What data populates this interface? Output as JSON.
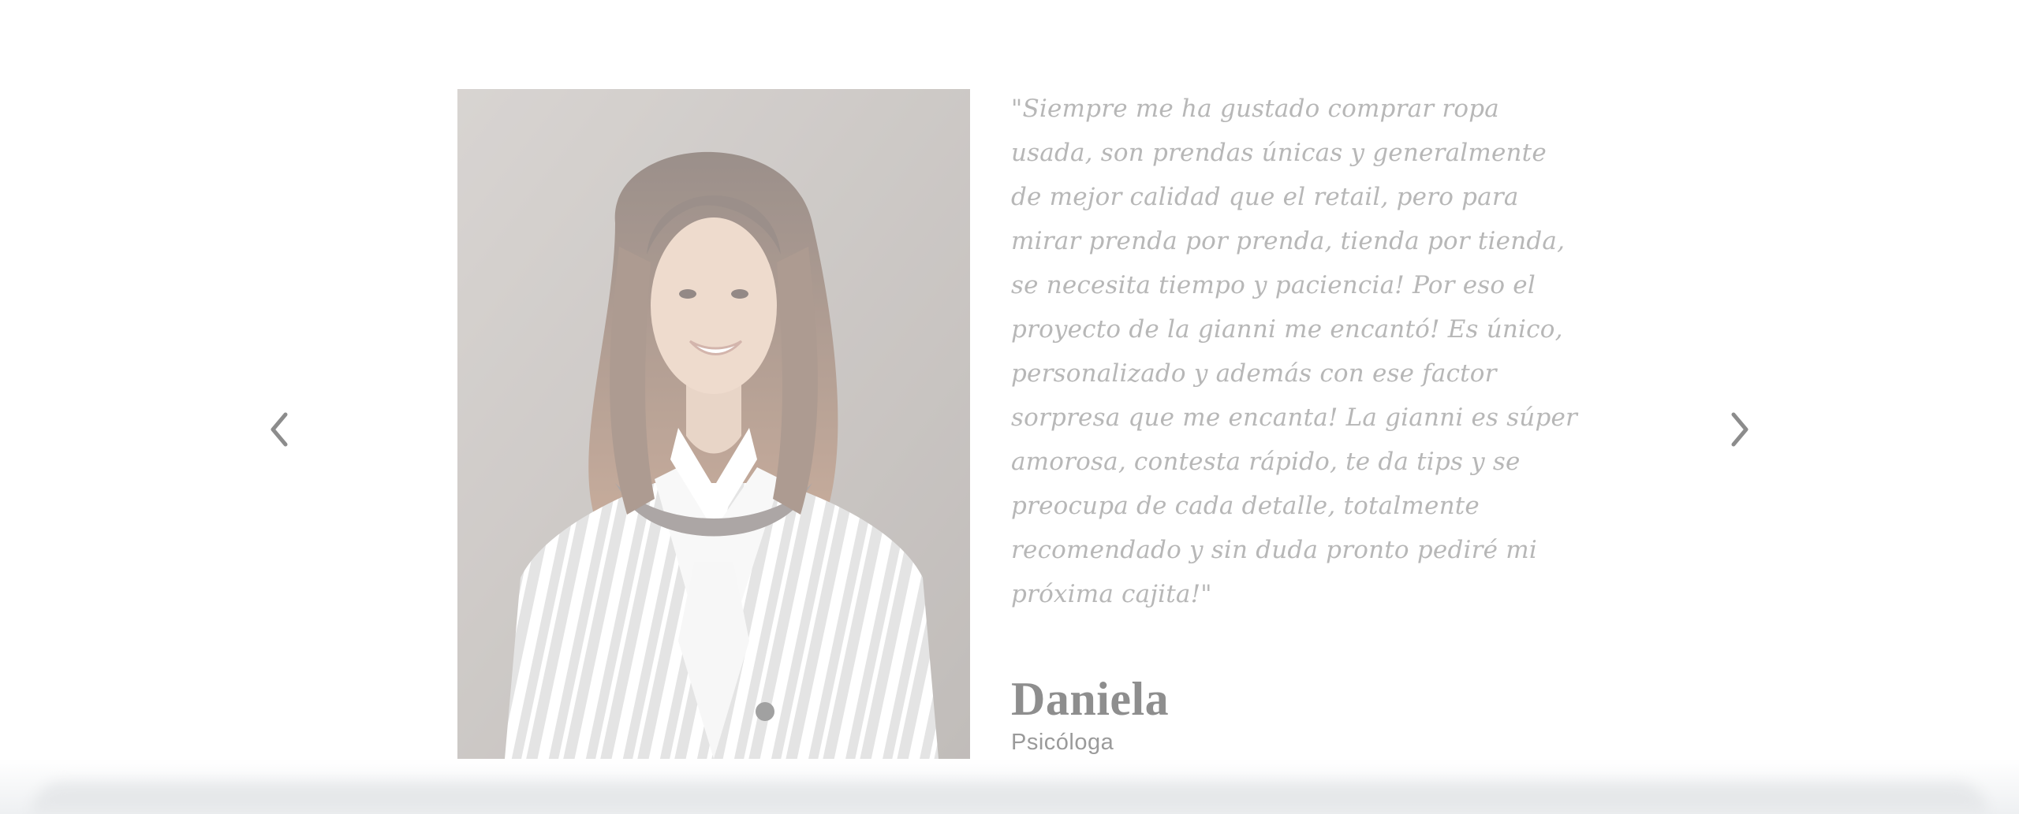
{
  "testimonial": {
    "quote": "\"Siempre me ha gustado comprar ropa usada, son prendas únicas y generalmente de mejor calidad que el retail, pero para mirar prenda por prenda, tienda por tienda, se necesita tiempo y paciencia! Por eso el proyecto de la gianni me encantó! Es único, personalizado y además con ese factor sorpresa que me encanta! La gianni es súper amorosa, contesta rápido, te da tips y se preocupa de cada detalle, totalmente recomendado y sin duda pronto pediré mi próxima cajita!\"",
    "name": "Daniela",
    "role": "Psicóloga"
  },
  "navigation": {
    "prev_icon": "chevron-left-icon",
    "next_icon": "chevron-right-icon"
  },
  "colors": {
    "quote_text": "#b7b7b7",
    "name_text": "#8e8e8e",
    "role_text": "#9a9a9a",
    "arrow": "#8c8c8c",
    "background": "#ffffff"
  }
}
